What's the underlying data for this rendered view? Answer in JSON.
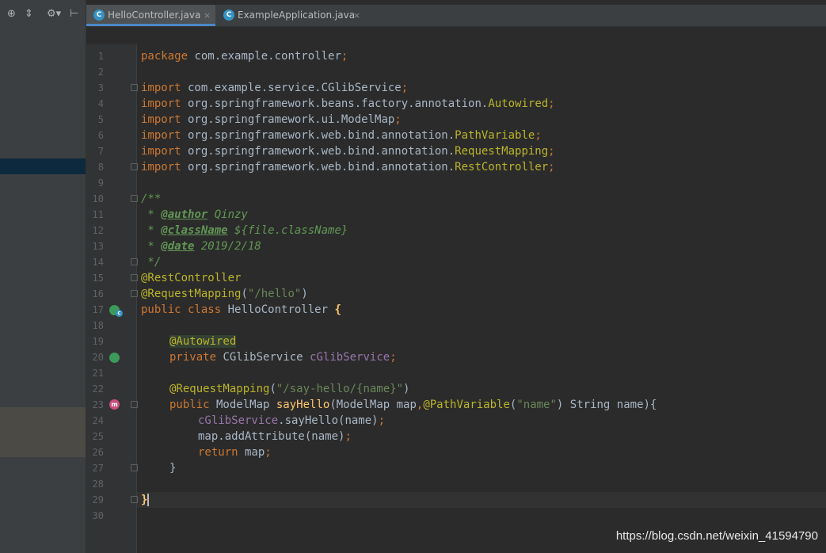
{
  "toolbar": {
    "locate_icon": "crosshair-icon",
    "collapse_icon": "collapse-icon",
    "settings_icon": "gear-icon",
    "hide_icon": "pin-icon",
    "locate_glyph": "⊕",
    "collapse_glyph": "⇕",
    "settings_glyph": "⚙▾",
    "hide_glyph": "⊢"
  },
  "tabs": [
    {
      "label": "HelloController.java",
      "icon": "C",
      "close": "×",
      "active": true
    },
    {
      "label": "ExampleApplication.java",
      "icon": "C",
      "close": "×",
      "active": false
    }
  ],
  "editor": {
    "line_numbers": [
      "1",
      "2",
      "3",
      "4",
      "5",
      "6",
      "7",
      "8",
      "9",
      "10",
      "11",
      "12",
      "13",
      "14",
      "15",
      "16",
      "17",
      "18",
      "19",
      "20",
      "21",
      "22",
      "23",
      "24",
      "25",
      "26",
      "27",
      "28",
      "29",
      "30"
    ],
    "lines": {
      "l1": {
        "kw": "package",
        "rest": " com.example.controller",
        "semi": ";"
      },
      "l3": {
        "kw": "import",
        "rest": " com.example.service.CGlibService",
        "semi": ";"
      },
      "l4": {
        "kw": "import",
        "rest": " org.springframework.beans.factory.annotation.",
        "ann": "Autowired",
        "semi": ";"
      },
      "l5": {
        "kw": "import",
        "rest": " org.springframework.ui.ModelMap",
        "semi": ";"
      },
      "l6": {
        "kw": "import",
        "rest": " org.springframework.web.bind.annotation.",
        "ann": "PathVariable",
        "semi": ";"
      },
      "l7": {
        "kw": "import",
        "rest": " org.springframework.web.bind.annotation.",
        "ann": "RequestMapping",
        "semi": ";"
      },
      "l8": {
        "kw": "import",
        "rest": " org.springframework.web.bind.annotation.",
        "ann": "RestController",
        "semi": ";"
      },
      "l10": {
        "doc": "/**"
      },
      "l11": {
        "star": " * ",
        "tag": "@author",
        "val": " Qinzy"
      },
      "l12": {
        "star": " * ",
        "tag": "@className",
        "val": " ${file.className}"
      },
      "l13": {
        "star": " * ",
        "tag": "@date",
        "val": " 2019/2/18"
      },
      "l14": {
        "doc": " */"
      },
      "l15": {
        "ann": "@RestController"
      },
      "l16": {
        "ann": "@RequestMapping",
        "open": "(",
        "str": "\"/hello\"",
        "close": ")"
      },
      "l17": {
        "kw": "public class",
        "rest": " HelloController ",
        "brace": "{"
      },
      "l19": {
        "ann": "@Autowired"
      },
      "l20": {
        "kw": "private",
        "rest": " CGlibService ",
        "fld": "cGlibService",
        "semi": ";"
      },
      "l22": {
        "ann": "@RequestMapping",
        "open": "(",
        "str": "\"/say-hello/{name}\"",
        "close": ")"
      },
      "l23": {
        "kw": "public",
        "rest": " ModelMap ",
        "fn": "sayHello",
        "p1": "(ModelMap map",
        "comma": ",",
        "ann": "@PathVariable",
        "open": "(",
        "str": "\"name\"",
        "p2": ") String name){"
      },
      "l24": {
        "fld": "cGlibService",
        "rest": ".sayHello(name)",
        "semi": ";"
      },
      "l25": {
        "rest": "map.addAttribute(name)",
        "semi": ";"
      },
      "l26": {
        "kw": "return",
        "rest": " map",
        "semi": ";"
      },
      "l27": {
        "rest": "}"
      },
      "l29": {
        "rest": "}"
      }
    }
  },
  "watermark": "https://blog.csdn.net/weixin_41594790",
  "colors": {
    "keyword": "#cc7832",
    "annotation": "#bbb529",
    "string": "#6a8759",
    "field": "#9876aa",
    "doc": "#629755",
    "text": "#a9b7c6",
    "background": "#2b2b2b"
  }
}
